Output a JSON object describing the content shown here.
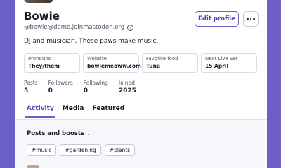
{
  "profile": {
    "name": "Bowie",
    "handle": "@bowie@demo.joinmastodon.org",
    "help_icon": "?",
    "bio": "DJ and musician. These paws make music.",
    "edit_label": "Edit profile"
  },
  "fields": [
    {
      "label": "Pronouns",
      "value": "They/them"
    },
    {
      "label": "Website",
      "value": "bowiemeoww.com"
    },
    {
      "label": "Favorite food",
      "value": "Tuna"
    },
    {
      "label": "Next Live Set",
      "value": "15 April"
    }
  ],
  "stats": [
    {
      "label": "Posts",
      "value": "5"
    },
    {
      "label": "Followers",
      "value": "0"
    },
    {
      "label": "Following",
      "value": "0"
    },
    {
      "label": "Joined",
      "value": "2025"
    }
  ],
  "tabs": [
    {
      "label": "Activity",
      "active": true
    },
    {
      "label": "Media",
      "active": false
    },
    {
      "label": "Featured",
      "active": false
    }
  ],
  "feed": {
    "filter_label": "Posts and boosts",
    "chevron": "⌄",
    "tags": [
      "#music",
      "#gardening",
      "#plants"
    ]
  },
  "colors": {
    "accent": "#6c5fc7",
    "accent_text": "#4a3fb5"
  },
  "icons": {
    "more": "more-horizontal-icon",
    "help": "help-circle-icon",
    "dropdown": "chevron-down-icon"
  }
}
